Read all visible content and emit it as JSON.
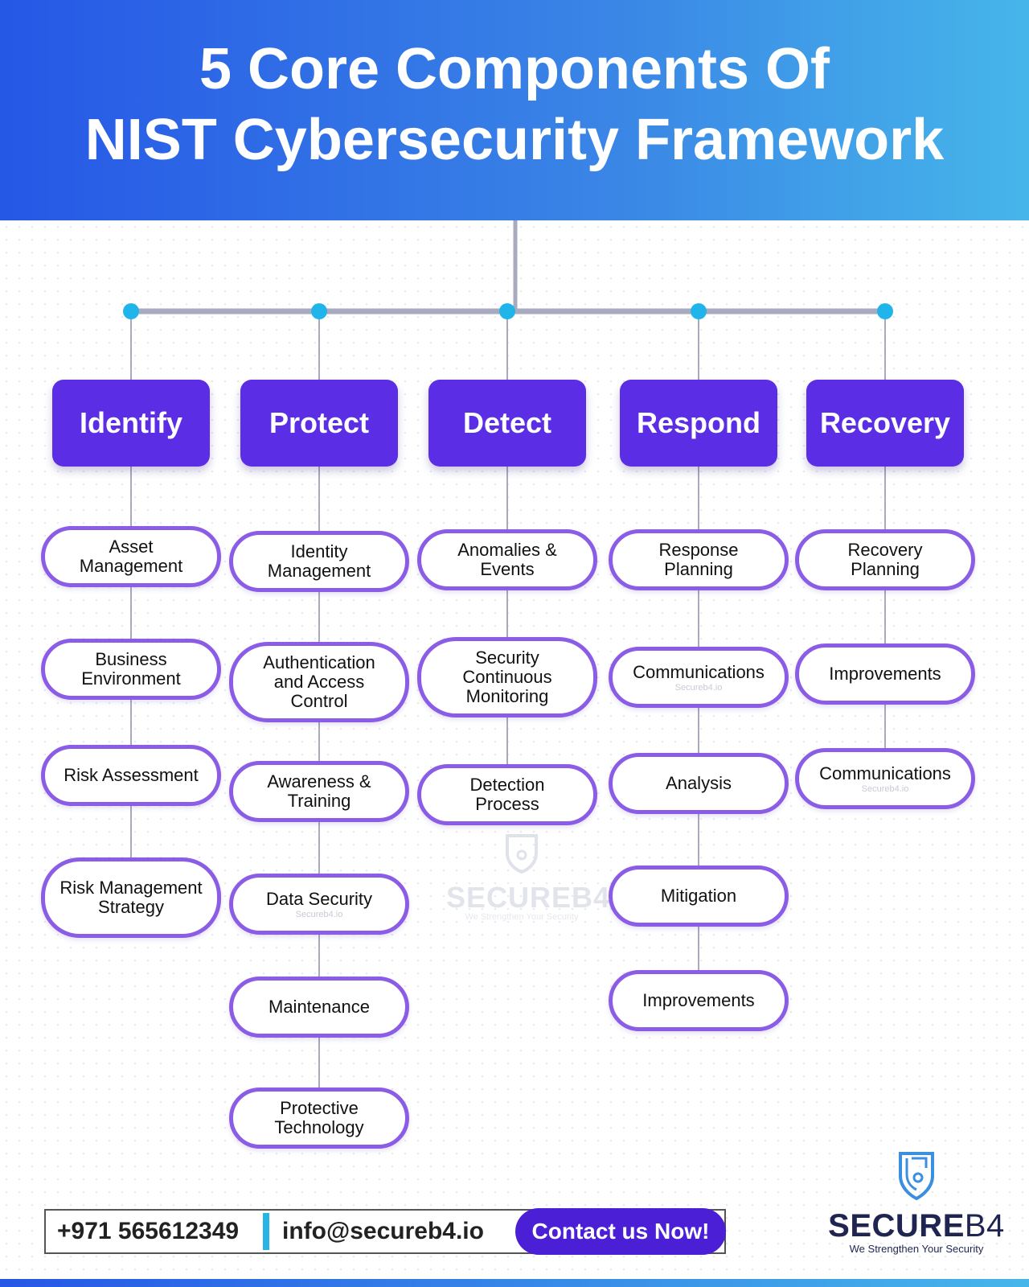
{
  "header": {
    "title_line1": "5 Core Components Of",
    "title_line2": "NIST Cybersecurity Framework",
    "gradient_start": "#2657e6",
    "gradient_end": "#46b6ea"
  },
  "colors": {
    "category_fill": "#5b2ee6",
    "pill_border": "#8b5ce6",
    "connector": "#a8aabf",
    "node_dot": "#1fb5ea"
  },
  "categories": [
    {
      "label": "Identify",
      "items": [
        {
          "text": "Asset Management",
          "watermark": ""
        },
        {
          "text": "Business Environment",
          "watermark": ""
        },
        {
          "text": "Risk Assessment",
          "watermark": ""
        },
        {
          "text": "Risk Management Strategy",
          "watermark": ""
        }
      ]
    },
    {
      "label": "Protect",
      "items": [
        {
          "text": "Identity Management",
          "watermark": ""
        },
        {
          "text": "Authentication and Access Control",
          "watermark": ""
        },
        {
          "text": "Awareness & Training",
          "watermark": ""
        },
        {
          "text": "Data Security",
          "watermark": "Secureb4.io"
        },
        {
          "text": "Maintenance",
          "watermark": ""
        },
        {
          "text": "Protective Technology",
          "watermark": ""
        }
      ]
    },
    {
      "label": "Detect",
      "items": [
        {
          "text": "Anomalies & Events",
          "watermark": ""
        },
        {
          "text": "Security Continuous Monitoring",
          "watermark": ""
        },
        {
          "text": "Detection Process",
          "watermark": ""
        }
      ]
    },
    {
      "label": "Respond",
      "items": [
        {
          "text": "Response Planning",
          "watermark": ""
        },
        {
          "text": "Communications",
          "watermark": "Secureb4.io"
        },
        {
          "text": "Analysis",
          "watermark": ""
        },
        {
          "text": "Mitigation",
          "watermark": ""
        },
        {
          "text": "Improvements",
          "watermark": ""
        }
      ]
    },
    {
      "label": "Recovery",
      "items": [
        {
          "text": "Recovery Planning",
          "watermark": ""
        },
        {
          "text": "Improvements",
          "watermark": ""
        },
        {
          "text": "Communications",
          "watermark": "Secureb4.io"
        }
      ]
    }
  ],
  "watermark_center": {
    "brand": "SECUREB4",
    "tagline": "We Strengthen Your Security"
  },
  "contact": {
    "phone": "+971 565612349",
    "email": "info@secureb4.io",
    "cta_label": "Contact us Now!"
  },
  "logo": {
    "brand_bold": "SECURE",
    "brand_light": "B4",
    "tagline": "We Strengthen Your Security",
    "icon": "shield-lock-icon"
  }
}
